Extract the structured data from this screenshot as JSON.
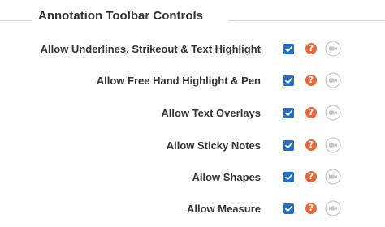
{
  "section": {
    "title": "Annotation Toolbar Controls"
  },
  "settings": [
    {
      "label": "Allow Underlines, Strikeout & Text Highlight",
      "checked": true
    },
    {
      "label": "Allow Free Hand Highlight & Pen",
      "checked": true
    },
    {
      "label": "Allow Text Overlays",
      "checked": true
    },
    {
      "label": "Allow Sticky Notes",
      "checked": true
    },
    {
      "label": "Allow Shapes",
      "checked": true
    },
    {
      "label": "Allow Measure",
      "checked": true
    }
  ],
  "help_glyph": "?",
  "icons": {
    "checkbox": "checkmark-icon",
    "help": "help-icon",
    "video": "video-camera-icon"
  },
  "colors": {
    "checkbox": "#1f6fd1",
    "help": "#e8663a",
    "video": "#c4c4c4",
    "text": "#333333"
  }
}
